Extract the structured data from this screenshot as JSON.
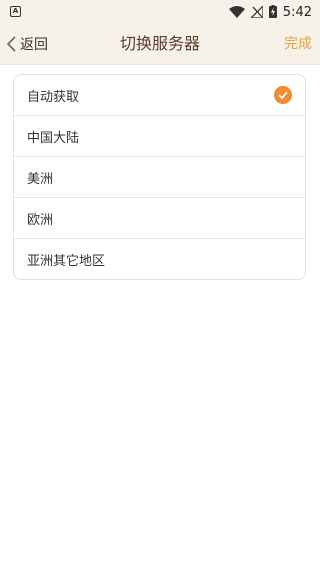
{
  "status_bar": {
    "time": "5:42",
    "notification_icon": "a-icon",
    "wifi_icon": "wifi-icon",
    "signal_icon": "no-signal-icon",
    "battery_icon": "battery-charging-icon"
  },
  "header": {
    "back_label": "返回",
    "title": "切换服务器",
    "done_label": "完成"
  },
  "servers": [
    {
      "label": "自动获取",
      "selected": true
    },
    {
      "label": "中国大陆",
      "selected": false
    },
    {
      "label": "美洲",
      "selected": false
    },
    {
      "label": "欧洲",
      "selected": false
    },
    {
      "label": "亚洲其它地区",
      "selected": false
    }
  ],
  "colors": {
    "header_bg": "#f6f1e9",
    "title": "#5a3e2b",
    "accent": "#e9a23b",
    "check": "#f08c2e"
  }
}
